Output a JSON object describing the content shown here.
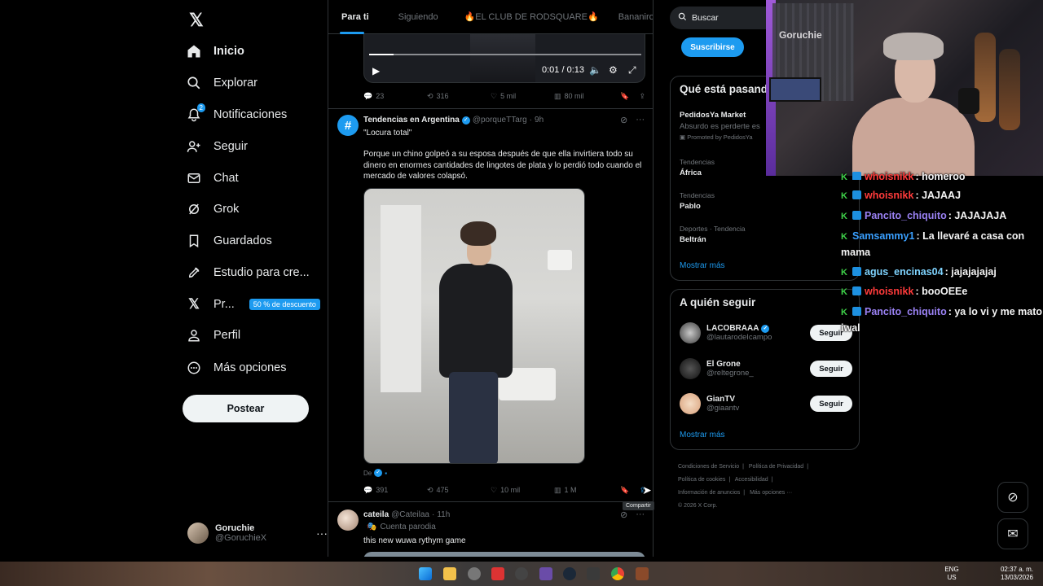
{
  "nav": {
    "items": [
      {
        "label": "Inicio",
        "icon": "home-icon"
      },
      {
        "label": "Explorar",
        "icon": "search-icon"
      },
      {
        "label": "Notificaciones",
        "icon": "bell-icon",
        "badge": "2"
      },
      {
        "label": "Seguir",
        "icon": "follow-icon"
      },
      {
        "label": "Chat",
        "icon": "mail-icon"
      },
      {
        "label": "Grok",
        "icon": "grok-icon"
      },
      {
        "label": "Guardados",
        "icon": "bookmark-icon"
      },
      {
        "label": "Estudio para cre...",
        "icon": "rocket-icon"
      },
      {
        "label": "Pr...",
        "icon": "x-logo-icon",
        "promo": "50 % de descuento"
      },
      {
        "label": "Perfil",
        "icon": "person-icon"
      },
      {
        "label": "Más opciones",
        "icon": "more-circle-icon"
      }
    ],
    "post_label": "Postear",
    "account": {
      "name": "Goruchie",
      "handle": "@GoruchieX"
    }
  },
  "feed": {
    "tabs": [
      "Para ti",
      "Siguiendo",
      "🔥EL CLUB DE RODSQUARE🔥",
      "Bananirou"
    ],
    "video": {
      "time": "0:01 / 0:13",
      "progress_pct": 9
    },
    "post1_stats": {
      "replies": "23",
      "reposts": "316",
      "likes": "5 mil",
      "views": "80 mil"
    },
    "post2": {
      "name": "Tendencias en Argentina",
      "handle": "@porqueTTarg",
      "time": "9h",
      "quote": "\"Locura total\"",
      "body": "Porque un chino golpeó a su esposa después de que ella invirtiera todo su dinero en enormes cantidades de lingotes de plata y lo perdió todo cuando el mercado de valores colapsó.",
      "credit": "De",
      "stats": {
        "replies": "391",
        "reposts": "475",
        "likes": "10 mil",
        "views": "1 M"
      },
      "share_tooltip": "Compartir"
    },
    "post3": {
      "name": "cateila",
      "handle": "@Cateilaa",
      "time": "11h",
      "label": "Cuenta parodia",
      "body": "this new wuwa rythym game"
    }
  },
  "right": {
    "search_placeholder": "Buscar",
    "subscribe_label": "Suscribirse",
    "trends_title": "Qué está pasando",
    "trends": [
      {
        "title": "PedidosYa Market",
        "desc": "Absurdo es perderte es",
        "promo": "Promoted by PedidosYa"
      },
      {
        "meta": "Tendencias",
        "title": "África"
      },
      {
        "meta": "Tendencias",
        "title": "Pablo"
      },
      {
        "meta": "Deportes · Tendencia",
        "title": "Beltrán"
      }
    ],
    "show_more": "Mostrar más",
    "follow_title": "A quién seguir",
    "follow": [
      {
        "name": "LACOBRAAA",
        "handle": "@lautarodeIcampo",
        "verified": true
      },
      {
        "name": "El Grone",
        "handle": "@reltegrone_"
      },
      {
        "name": "GianTV",
        "handle": "@giaantv"
      }
    ],
    "follow_label": "Seguir",
    "footer": [
      "Condiciones de Servicio",
      "|",
      "Política de Privacidad",
      "|",
      "Política de cookies",
      "|",
      "Accesibilidad",
      "|",
      "Información de anuncios",
      "|",
      "Más opciones ···",
      "© 2026 X Corp."
    ]
  },
  "webcam": {
    "name": "Goruchie"
  },
  "chat": [
    {
      "user": "whoisnikk",
      "color": "#ff3b3b",
      "msg": "homeroo"
    },
    {
      "user": "whoisnikk",
      "color": "#ff3b3b",
      "msg": "JAJAAJ"
    },
    {
      "user": "Pancito_chiquito",
      "color": "#9b82f5",
      "msg": "JAJAJAJA"
    },
    {
      "user": "Samsammy1",
      "color": "#3aa0ff",
      "msg": "La llevaré a casa con mama"
    },
    {
      "user": "agus_encinas04",
      "color": "#7fd4ff",
      "msg": "jajajajajaj"
    },
    {
      "user": "whoisnikk",
      "color": "#ff3b3b",
      "msg": "booOEEe"
    },
    {
      "user": "Pancito_chiquito",
      "color": "#9b82f5",
      "msg": "ya lo vi y me mato iwal"
    }
  ],
  "taskbar": {
    "lang1": "ENG",
    "lang2": "US",
    "time": "02:37 a. m.",
    "date": "13/03/2026"
  }
}
